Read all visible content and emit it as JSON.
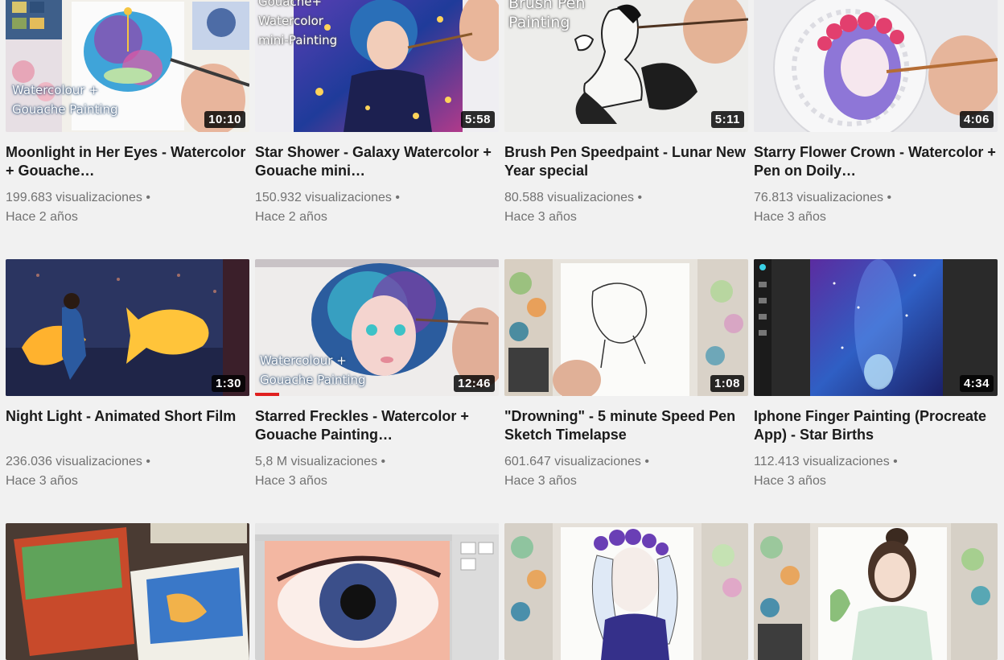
{
  "videos": [
    {
      "title": "Moonlight in Her Eyes - Watercolor + Gouache…",
      "views": "199.683 visualizaciones",
      "age": "Hace 2 años",
      "duration": "10:10",
      "overlay": "Watercolour +\nGouache Painting",
      "icon": "video-thumbnail"
    },
    {
      "title": "Star Shower - Galaxy Watercolor + Gouache mini…",
      "views": "150.932 visualizaciones",
      "age": "Hace 2 años",
      "duration": "5:58",
      "overlay": "Gouache+\nWatercolor\nmini-Painting",
      "icon": "video-thumbnail"
    },
    {
      "title": "Brush Pen Speedpaint - Lunar New Year special",
      "views": "80.588 visualizaciones",
      "age": "Hace 3 años",
      "duration": "5:11",
      "overlay": "Brush Pen\nPainting",
      "icon": "video-thumbnail"
    },
    {
      "title": "Starry Flower Crown - Watercolor + Pen on Doily…",
      "views": "76.813 visualizaciones",
      "age": "Hace 3 años",
      "duration": "4:06",
      "overlay": "",
      "icon": "video-thumbnail"
    },
    {
      "title": "Night Light - Animated Short Film",
      "views": "236.036 visualizaciones",
      "age": "Hace 3 años",
      "duration": "1:30",
      "overlay": "",
      "icon": "video-thumbnail"
    },
    {
      "title": "Starred Freckles - Watercolor + Gouache Painting…",
      "views": "5,8 M visualizaciones",
      "age": "Hace 3 años",
      "duration": "12:46",
      "overlay": "Watercolour +\nGouache Painting",
      "watched_fraction": 0.1,
      "icon": "video-thumbnail"
    },
    {
      "title": "\"Drowning\" - 5 minute Speed Pen Sketch Timelapse",
      "views": "601.647 visualizaciones",
      "age": "Hace 3 años",
      "duration": "1:08",
      "overlay": "",
      "icon": "video-thumbnail"
    },
    {
      "title": "Iphone Finger Painting (Procreate App) - Star Births",
      "views": "112.413 visualizaciones",
      "age": "Hace 3 años",
      "duration": "4:34",
      "overlay": "",
      "icon": "video-thumbnail"
    },
    {
      "title": "",
      "views": "",
      "age": "",
      "duration": "",
      "overlay": "",
      "icon": "video-thumbnail"
    },
    {
      "title": "",
      "views": "",
      "age": "",
      "duration": "",
      "overlay": "",
      "icon": "video-thumbnail"
    },
    {
      "title": "",
      "views": "",
      "age": "",
      "duration": "",
      "overlay": "",
      "icon": "video-thumbnail"
    },
    {
      "title": "",
      "views": "",
      "age": "",
      "duration": "",
      "overlay": "",
      "icon": "video-thumbnail"
    }
  ],
  "colors": {
    "background": "#f1f1f1",
    "title": "#1b1b1b",
    "meta": "#727272",
    "duration_badge": "#000000",
    "progress": "#e0201f"
  }
}
